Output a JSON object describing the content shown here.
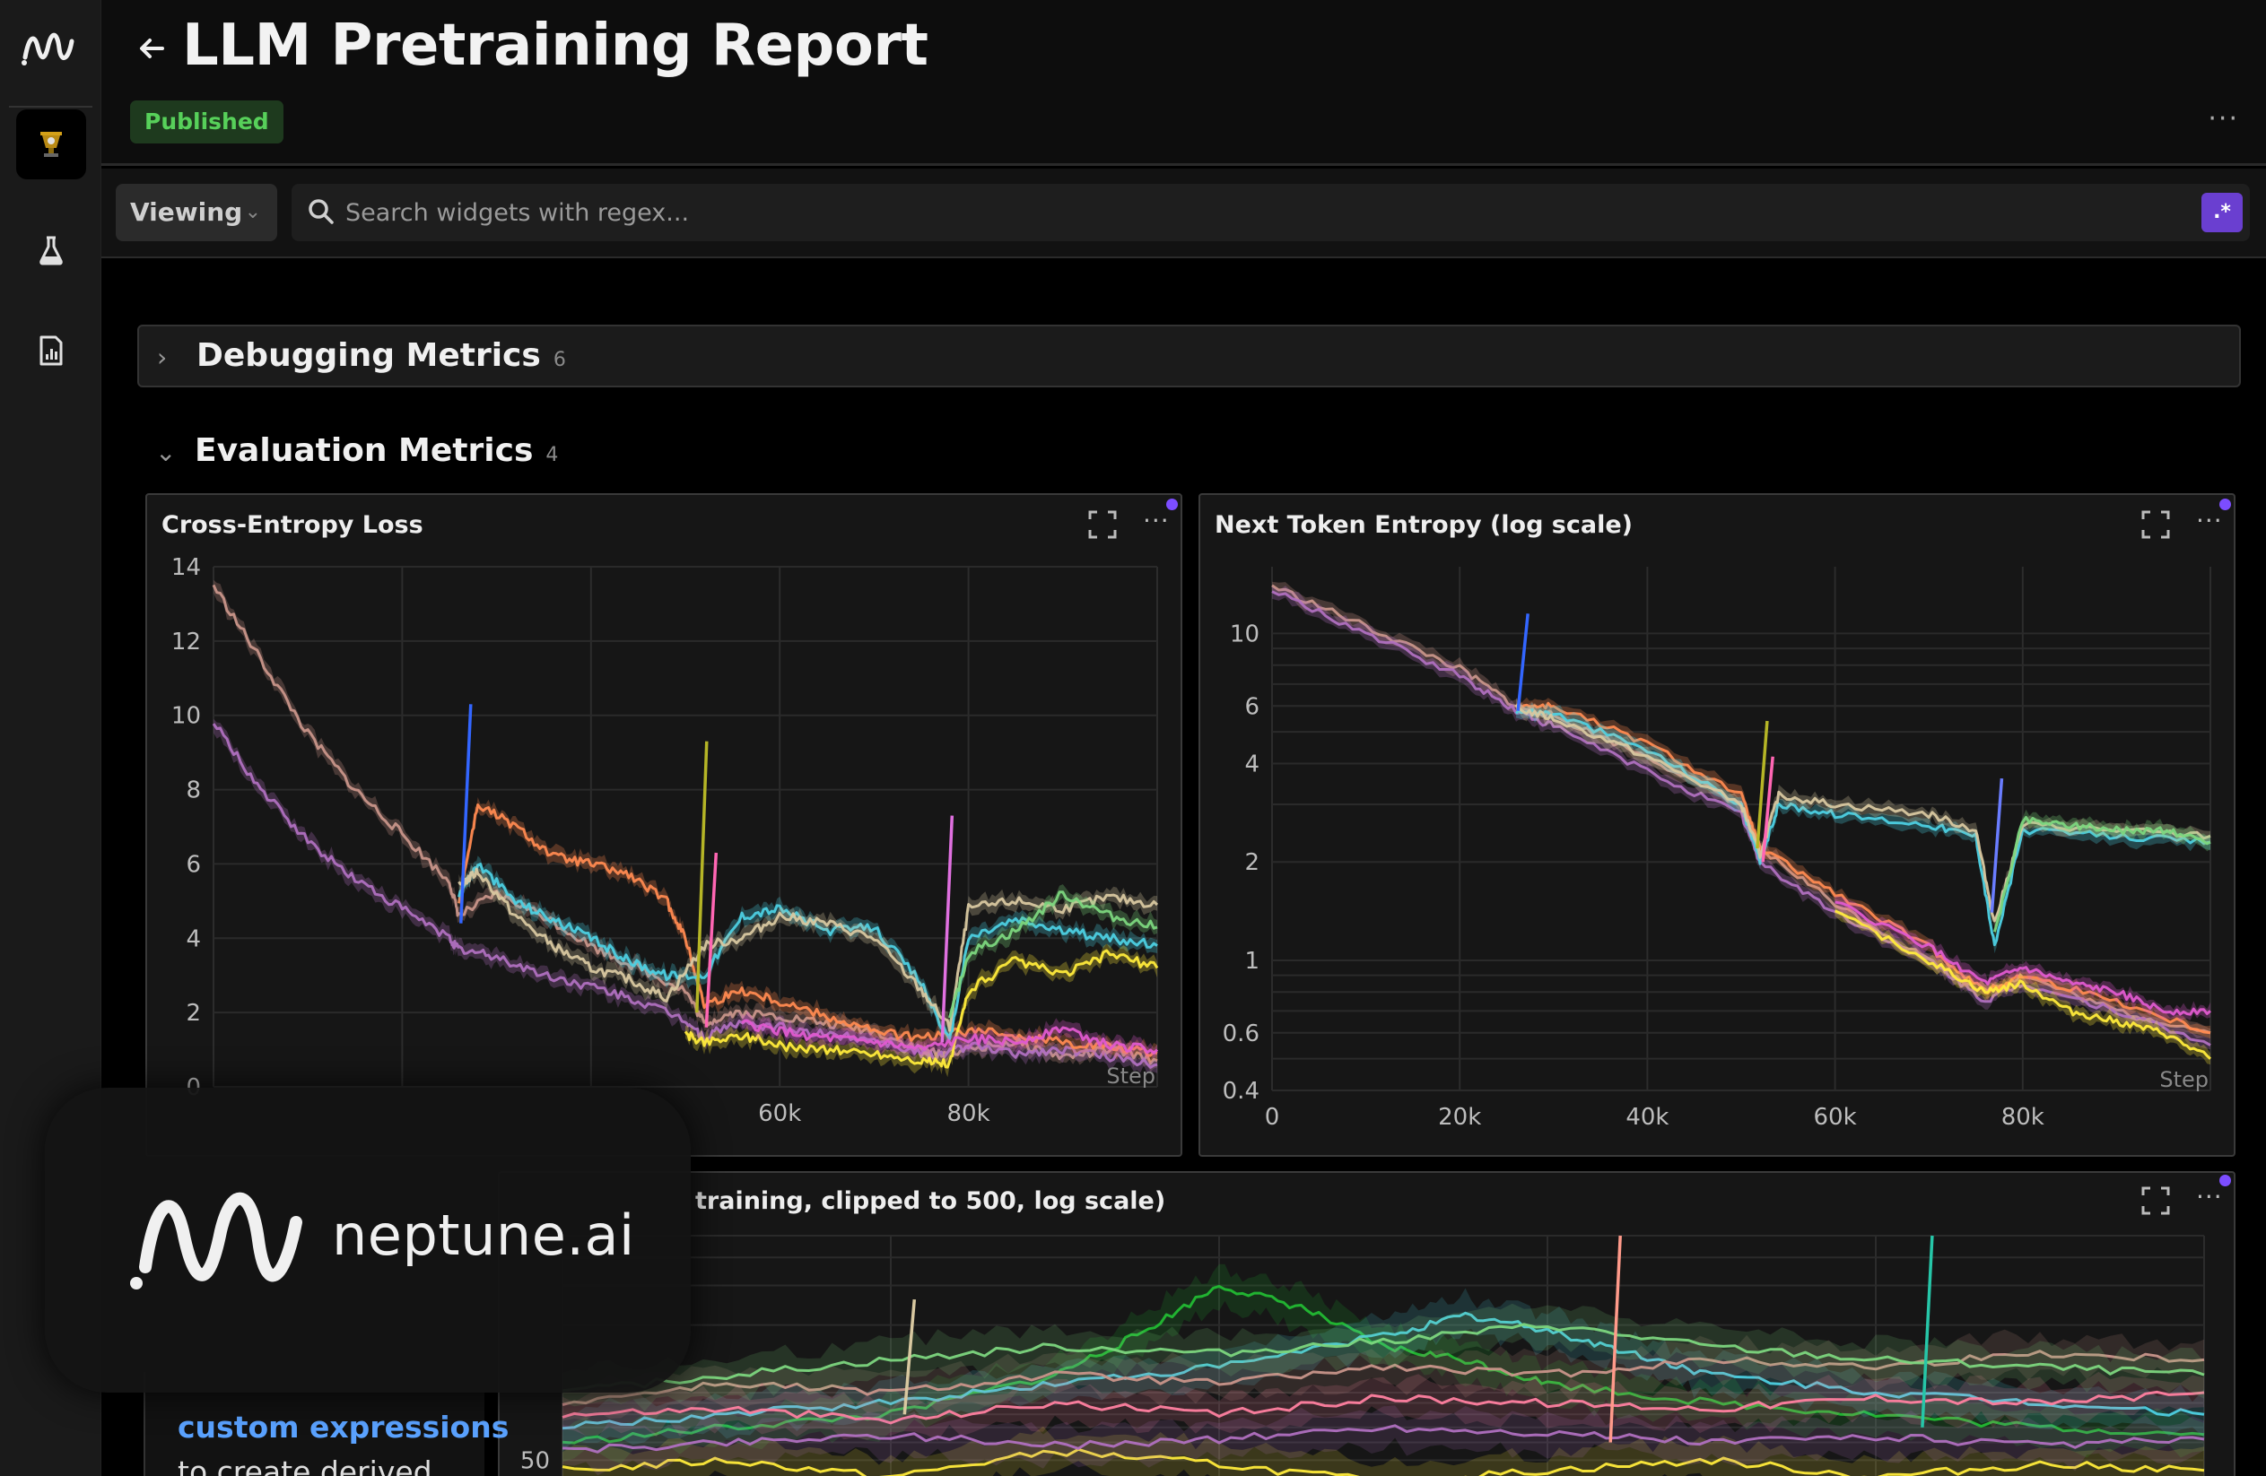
{
  "app": {
    "title": "LLM Pretraining Report",
    "status_badge": "Published",
    "more": "···"
  },
  "toolbar": {
    "mode_label": "Viewing",
    "search_placeholder": "Search widgets with regex...",
    "regex_label": ".*"
  },
  "sections": [
    {
      "title": "Debugging Metrics",
      "count": "6",
      "expanded": false
    },
    {
      "title": "Evaluation Metrics",
      "count": "4",
      "expanded": true
    }
  ],
  "overlay": {
    "brand": "neptune.ai",
    "tip_link": "custom expressions",
    "tip_text": "to create derived"
  },
  "colors": {
    "accent": "#7c4dff",
    "badge_bg": "#1e3a1e",
    "badge_text": "#57d05a",
    "link": "#5aa2ff"
  },
  "chart_data": [
    {
      "type": "line",
      "title": "Cross-Entropy Loss",
      "xlabel": "Step",
      "x_tick_labels": [
        "60k",
        "80k"
      ],
      "y_tick_labels": [
        "0",
        "2",
        "4",
        "6",
        "8",
        "10",
        "12",
        "14"
      ],
      "xlim": [
        0,
        100000
      ],
      "ylim": [
        0,
        14
      ],
      "grid": true,
      "series": [
        {
          "color": "#c9958a",
          "x": [
            0,
            5000,
            10000,
            15000,
            20000,
            25000,
            26000,
            30000,
            35000,
            40000,
            45000,
            50000,
            52000,
            55000,
            60000,
            65000,
            70000,
            75000,
            76000,
            80000,
            85000,
            90000,
            95000,
            100000
          ],
          "y": [
            13.5,
            11.5,
            9.5,
            8.0,
            6.8,
            5.5,
            4.6,
            5.2,
            4.6,
            3.8,
            3.2,
            2.6,
            1.7,
            2.0,
            1.9,
            1.7,
            1.5,
            1.0,
            0.9,
            1.0,
            1.2,
            0.8,
            1.0,
            0.7
          ]
        },
        {
          "color": "#b070c0",
          "x": [
            0,
            5000,
            10000,
            15000,
            20000,
            25000,
            26000,
            30000,
            35000,
            40000,
            45000,
            50000,
            52000,
            55000,
            60000,
            65000,
            70000,
            75000,
            76000,
            80000,
            85000,
            90000,
            95000,
            100000
          ],
          "y": [
            9.8,
            8.0,
            6.6,
            5.6,
            4.8,
            4.0,
            3.7,
            3.5,
            3.0,
            2.7,
            2.3,
            1.8,
            1.3,
            1.7,
            1.6,
            1.4,
            1.3,
            0.9,
            0.8,
            1.1,
            0.9,
            1.0,
            0.8,
            0.6
          ]
        },
        {
          "color": "#ff8a50",
          "x": [
            26000,
            28000,
            32000,
            36000,
            40000,
            44000,
            48000,
            50000,
            52000,
            56000,
            60000,
            65000,
            70000,
            75000,
            80000,
            85000,
            90000,
            95000,
            100000
          ],
          "y": [
            5.0,
            7.6,
            7.0,
            6.2,
            6.0,
            5.7,
            5.0,
            4.0,
            2.2,
            2.6,
            2.3,
            1.9,
            1.5,
            1.3,
            1.5,
            1.4,
            1.2,
            1.1,
            0.9
          ]
        },
        {
          "color": "#4dd0e1",
          "x": [
            26000,
            28000,
            32000,
            36000,
            40000,
            44000,
            48000,
            52000,
            56000,
            60000,
            65000,
            70000,
            75000,
            78000,
            80000,
            85000,
            90000,
            95000,
            100000
          ],
          "y": [
            5.2,
            6.0,
            5.0,
            4.5,
            4.0,
            3.4,
            3.0,
            3.0,
            4.6,
            4.8,
            4.2,
            4.3,
            2.8,
            1.2,
            4.0,
            4.5,
            4.2,
            4.0,
            3.8
          ]
        },
        {
          "color": "#d8c8a0",
          "x": [
            26000,
            28000,
            32000,
            36000,
            40000,
            44000,
            48000,
            52000,
            56000,
            60000,
            65000,
            70000,
            75000,
            78000,
            80000,
            85000,
            90000,
            95000,
            100000
          ],
          "y": [
            5.4,
            5.8,
            4.6,
            3.8,
            3.2,
            2.9,
            2.4,
            3.8,
            4.0,
            4.6,
            4.4,
            4.0,
            2.6,
            1.6,
            4.8,
            5.0,
            4.8,
            5.1,
            4.9
          ]
        },
        {
          "color": "#ffeb3b",
          "x": [
            50000,
            52000,
            56000,
            60000,
            65000,
            70000,
            75000,
            78000,
            80000,
            85000,
            90000,
            95000,
            100000
          ],
          "y": [
            1.4,
            1.2,
            1.4,
            1.1,
            1.0,
            0.9,
            0.7,
            0.6,
            2.6,
            3.4,
            3.0,
            3.6,
            3.2
          ]
        },
        {
          "color": "#7cd67e",
          "x": [
            78000,
            80000,
            85000,
            90000,
            95000,
            100000
          ],
          "y": [
            1.8,
            3.6,
            4.2,
            5.2,
            4.6,
            4.3
          ]
        },
        {
          "color": "#e05ad0",
          "x": [
            56000,
            60000,
            65000,
            70000,
            75000,
            80000,
            85000,
            90000,
            95000,
            100000
          ],
          "y": [
            1.7,
            1.5,
            1.3,
            1.2,
            1.0,
            1.3,
            1.2,
            1.6,
            1.1,
            1.0
          ]
        }
      ],
      "spikes": [
        {
          "color": "#3366ff",
          "x": 26500,
          "from": 4.4,
          "to": 10.3
        },
        {
          "color": "#b5b526",
          "x": 51500,
          "from": 2.0,
          "to": 9.3
        },
        {
          "color": "#ff66b3",
          "x": 52500,
          "from": 1.6,
          "to": 6.3
        },
        {
          "color": "#e070e0",
          "x": 77500,
          "from": 1.2,
          "to": 7.3
        }
      ]
    },
    {
      "type": "line",
      "title": "Next Token Entropy (log scale)",
      "xlabel": "Step",
      "x_tick_labels": [
        "0",
        "20k",
        "40k",
        "60k",
        "80k"
      ],
      "y_tick_labels": [
        "0.4",
        "0.6",
        "1",
        "2",
        "4",
        "6",
        "10"
      ],
      "xlim": [
        0,
        100000
      ],
      "ylim": [
        0.4,
        16
      ],
      "yscale": "log",
      "grid": true,
      "series": [
        {
          "color": "#c9958a",
          "x": [
            0,
            10000,
            20000,
            26000,
            30000,
            40000,
            50000,
            52000,
            60000,
            70000,
            76000,
            80000,
            90000,
            100000
          ],
          "y": [
            14,
            10.5,
            7.8,
            6.0,
            5.6,
            4.2,
            3.0,
            2.2,
            1.5,
            1.0,
            0.8,
            0.9,
            0.7,
            0.6
          ]
        },
        {
          "color": "#b070c0",
          "x": [
            0,
            10000,
            20000,
            26000,
            30000,
            40000,
            50000,
            52000,
            60000,
            70000,
            76000,
            80000,
            90000,
            100000
          ],
          "y": [
            13.5,
            10,
            7.4,
            5.8,
            5.2,
            3.8,
            2.8,
            2.0,
            1.4,
            1.0,
            0.75,
            0.85,
            0.7,
            0.55
          ]
        },
        {
          "color": "#ff8a50",
          "x": [
            26000,
            30000,
            40000,
            50000,
            52000,
            60000,
            70000,
            76000,
            80000,
            90000,
            100000
          ],
          "y": [
            6.0,
            6.0,
            4.6,
            3.2,
            2.2,
            1.6,
            1.1,
            0.8,
            0.9,
            0.75,
            0.6
          ]
        },
        {
          "color": "#4dd0e1",
          "x": [
            26000,
            30000,
            40000,
            50000,
            52000,
            54000,
            60000,
            70000,
            75000,
            77000,
            80000,
            90000,
            100000
          ],
          "y": [
            5.8,
            5.7,
            4.4,
            3.0,
            2.0,
            3.0,
            2.8,
            2.6,
            2.4,
            1.1,
            2.5,
            2.4,
            2.3
          ]
        },
        {
          "color": "#d8c8a0",
          "x": [
            26000,
            30000,
            40000,
            50000,
            52000,
            54000,
            60000,
            70000,
            75000,
            77000,
            80000,
            90000,
            100000
          ],
          "y": [
            5.9,
            5.5,
            4.2,
            3.0,
            2.1,
            3.2,
            3.0,
            2.8,
            2.5,
            1.3,
            2.6,
            2.5,
            2.4
          ]
        },
        {
          "color": "#7cd67e",
          "x": [
            77000,
            80000,
            85000,
            90000,
            95000,
            100000
          ],
          "y": [
            1.2,
            2.7,
            2.6,
            2.5,
            2.5,
            2.3
          ]
        },
        {
          "color": "#ffeb3b",
          "x": [
            60000,
            70000,
            76000,
            80000,
            85000,
            90000,
            95000,
            100000
          ],
          "y": [
            1.4,
            1.0,
            0.8,
            0.85,
            0.7,
            0.65,
            0.6,
            0.5
          ]
        },
        {
          "color": "#e05ad0",
          "x": [
            60000,
            70000,
            76000,
            80000,
            85000,
            90000,
            95000,
            100000
          ],
          "y": [
            1.5,
            1.1,
            0.85,
            0.95,
            0.85,
            0.8,
            0.7,
            0.7
          ]
        }
      ],
      "spikes": [
        {
          "color": "#3366ff",
          "x": 26500,
          "from": 5.8,
          "to": 11.5
        },
        {
          "color": "#b5b526",
          "x": 52000,
          "from": 2.2,
          "to": 5.4
        },
        {
          "color": "#ff66b3",
          "x": 52600,
          "from": 2.0,
          "to": 4.2
        },
        {
          "color": "#6a7dff",
          "x": 77000,
          "from": 1.4,
          "to": 3.6
        }
      ]
    },
    {
      "type": "line",
      "title": "training, clipped to 500, log scale)",
      "y_tick_labels": [
        "50"
      ],
      "xlim": [
        0,
        100000
      ],
      "ylim": [
        20,
        500
      ],
      "yscale": "log",
      "grid": true,
      "series": [
        {
          "color": "#22bb33",
          "x": [
            0,
            10000,
            20000,
            30000,
            35000,
            40000,
            45000,
            50000,
            55000,
            60000,
            70000,
            80000,
            90000,
            100000
          ],
          "y": [
            60,
            70,
            80,
            120,
            180,
            300,
            240,
            160,
            140,
            110,
            90,
            80,
            70,
            65
          ]
        },
        {
          "color": "#4dd0e1",
          "x": [
            0,
            10000,
            20000,
            30000,
            40000,
            50000,
            55000,
            60000,
            65000,
            70000,
            80000,
            90000,
            100000
          ],
          "y": [
            70,
            80,
            90,
            110,
            130,
            180,
            220,
            190,
            150,
            120,
            100,
            90,
            80
          ]
        },
        {
          "color": "#c9958a",
          "x": [
            0,
            10000,
            20000,
            30000,
            40000,
            50000,
            60000,
            70000,
            80000,
            90000,
            100000
          ],
          "y": [
            90,
            110,
            100,
            120,
            110,
            130,
            120,
            140,
            130,
            150,
            140
          ]
        },
        {
          "color": "#ff80a0",
          "x": [
            0,
            10000,
            20000,
            30000,
            40000,
            50000,
            60000,
            70000,
            80000,
            90000,
            100000
          ],
          "y": [
            80,
            85,
            75,
            90,
            80,
            95,
            90,
            85,
            95,
            90,
            100
          ]
        },
        {
          "color": "#ffeb3b",
          "x": [
            0,
            10000,
            20000,
            30000,
            40000,
            50000,
            60000,
            70000,
            80000,
            90000,
            100000
          ],
          "y": [
            45,
            50,
            42,
            55,
            48,
            40,
            45,
            50,
            42,
            48,
            45
          ]
        },
        {
          "color": "#b070c0",
          "x": [
            0,
            10000,
            20000,
            30000,
            40000,
            50000,
            60000,
            70000,
            80000,
            90000,
            100000
          ],
          "y": [
            55,
            60,
            65,
            58,
            62,
            70,
            66,
            60,
            64,
            58,
            62
          ]
        },
        {
          "color": "#7cd67e",
          "x": [
            0,
            10000,
            20000,
            30000,
            40000,
            50000,
            60000,
            70000,
            80000,
            90000,
            100000
          ],
          "y": [
            100,
            120,
            140,
            160,
            150,
            170,
            200,
            160,
            140,
            130,
            120
          ]
        }
      ],
      "spikes": [
        {
          "color": "#ff9a8a",
          "x": 64000,
          "from": 60,
          "to": 500
        },
        {
          "color": "#26c6a8",
          "x": 83000,
          "from": 70,
          "to": 500
        },
        {
          "color": "#d8c8a0",
          "x": 21000,
          "from": 80,
          "to": 260
        }
      ]
    }
  ]
}
